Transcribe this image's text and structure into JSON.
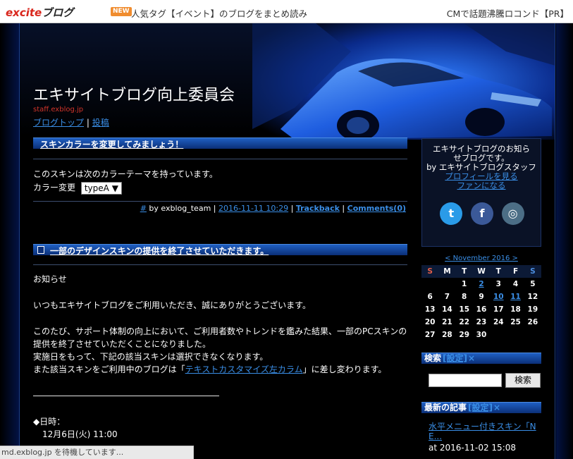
{
  "topbar": {
    "logo_main": "excite",
    "logo_sub": "ブログ",
    "news_badge": "NEW",
    "news_text": "人気タグ【イベント】のブログをまとめ読み",
    "promo_text": "CMで話題沸騰ロコンド【PR】"
  },
  "blog": {
    "title": "エキサイトブログ向上委員会",
    "url": "staff.exblog.jp",
    "nav_top": "ブログトップ",
    "nav_sep": "|",
    "nav_post": "投稿"
  },
  "post1": {
    "title": "スキンカラーを変更してみましょう！",
    "line1": "このスキンは次のカラーテーマを持っています。",
    "color_label": "カラー変更",
    "color_value": "typeA",
    "meta_hash": "#",
    "meta_by": " by exblog_team",
    "meta_date": "2016-11-11 10:29",
    "meta_trackback": "Trackback",
    "meta_comments": "Comments(0)"
  },
  "post2": {
    "title": "一部のデザインスキンの提供を終了させていただきます。",
    "p1": "お知らせ",
    "p2": "いつもエキサイトブログをご利用いただき、誠にありがとうございます。",
    "p3a": "このたび、サポート体制の向上において、ご利用者数やトレンドを鑑みた結果、一部のPCスキンの",
    "p3b": "提供を終了させていただくことになりました。",
    "p4": "実施日をもって、下記の該当スキンは選択できなくなります。",
    "p5a": "また該当スキンをご利用中のブログは「",
    "p5link": "テキストカスタマイズ左カラム",
    "p5b": "」に差し変わります。",
    "divider": "――――――――――――――――――――――",
    "date_label": "◆日時：",
    "date_value": "12月6日(火) 11:00"
  },
  "profile": {
    "line1": "エキサイトブログのお知ら",
    "line2": "せブログです。",
    "line3": "by エキサイトブログスタッフ",
    "link_profile": "プロフィールを見る",
    "link_fan": "ファンになる"
  },
  "social": {
    "twitter": "t",
    "facebook": "f",
    "instagram": "◎"
  },
  "calendar": {
    "title": "< November 2016 >",
    "weekdays": [
      "S",
      "M",
      "T",
      "W",
      "T",
      "F",
      "S"
    ],
    "weeks": [
      [
        "",
        "",
        "1",
        "2",
        "3",
        "4",
        "5"
      ],
      [
        "6",
        "7",
        "8",
        "9",
        "10",
        "11",
        "12"
      ],
      [
        "13",
        "14",
        "15",
        "16",
        "17",
        "18",
        "19"
      ],
      [
        "20",
        "21",
        "22",
        "23",
        "24",
        "25",
        "26"
      ],
      [
        "27",
        "28",
        "29",
        "30",
        "",
        "",
        ""
      ]
    ],
    "linked_days": [
      "2",
      "10",
      "11"
    ]
  },
  "search": {
    "heading": "検索",
    "setting": "[設定]",
    "close": "×",
    "button": "検索",
    "value": ""
  },
  "latest": {
    "heading": "最新の記事",
    "setting": "[設定]",
    "close": "×",
    "item1_title": "水平メニュー付きスキン「N E...",
    "item1_date": "at 2016-11-02 15:08"
  },
  "status_text": "md.exblog.jp を待機しています...",
  "colors": {
    "accent_link": "#3a8ee6",
    "header_bar": "#1f5fc3",
    "url_red": "#d2342a"
  }
}
